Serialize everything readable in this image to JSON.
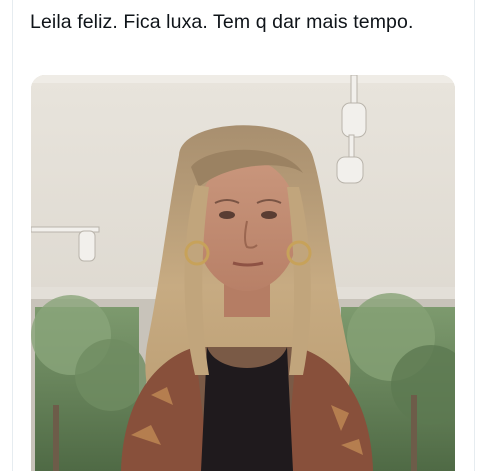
{
  "tweet": {
    "text": "Leila feliz. Fica luxa. Tem q dar mais tempo."
  },
  "media": {
    "type": "photo",
    "subject": "woman-portrait-photo"
  },
  "colors": {
    "text": "#0f1419",
    "divider": "#e6ecf0",
    "background": "#ffffff"
  }
}
